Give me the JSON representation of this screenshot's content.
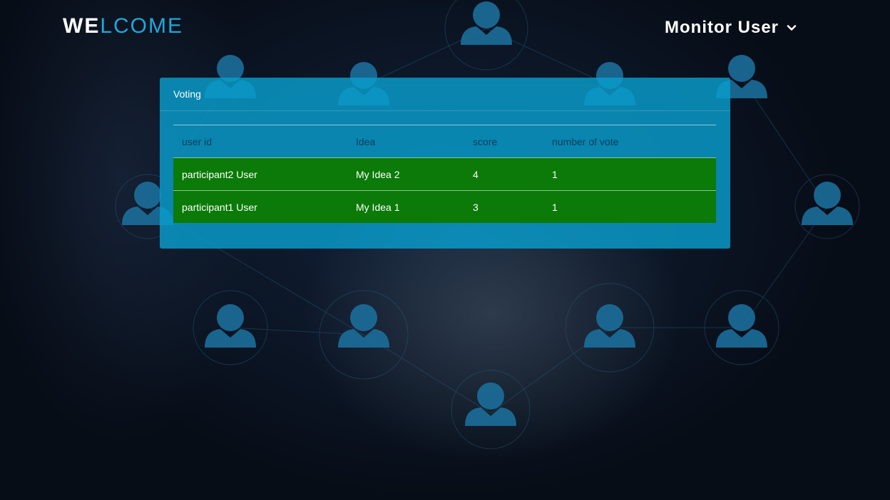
{
  "header": {
    "logo_bold": "WE",
    "logo_light": "LCOME",
    "user_menu_label": "Monitor User"
  },
  "panel": {
    "title": "Voting",
    "columns": [
      "user id",
      "Idea",
      "score",
      "number of vote"
    ],
    "rows": [
      {
        "user_id": "participant2 User",
        "idea": "My Idea 2",
        "score": "4",
        "votes": "1"
      },
      {
        "user_id": "participant1 User",
        "idea": "My Idea 1",
        "score": "3",
        "votes": "1"
      }
    ]
  },
  "colors": {
    "accent": "#20a7d8",
    "panel": "#099ecd",
    "row_highlight": "#0b7a08",
    "header_text": "#0b3e5a"
  }
}
